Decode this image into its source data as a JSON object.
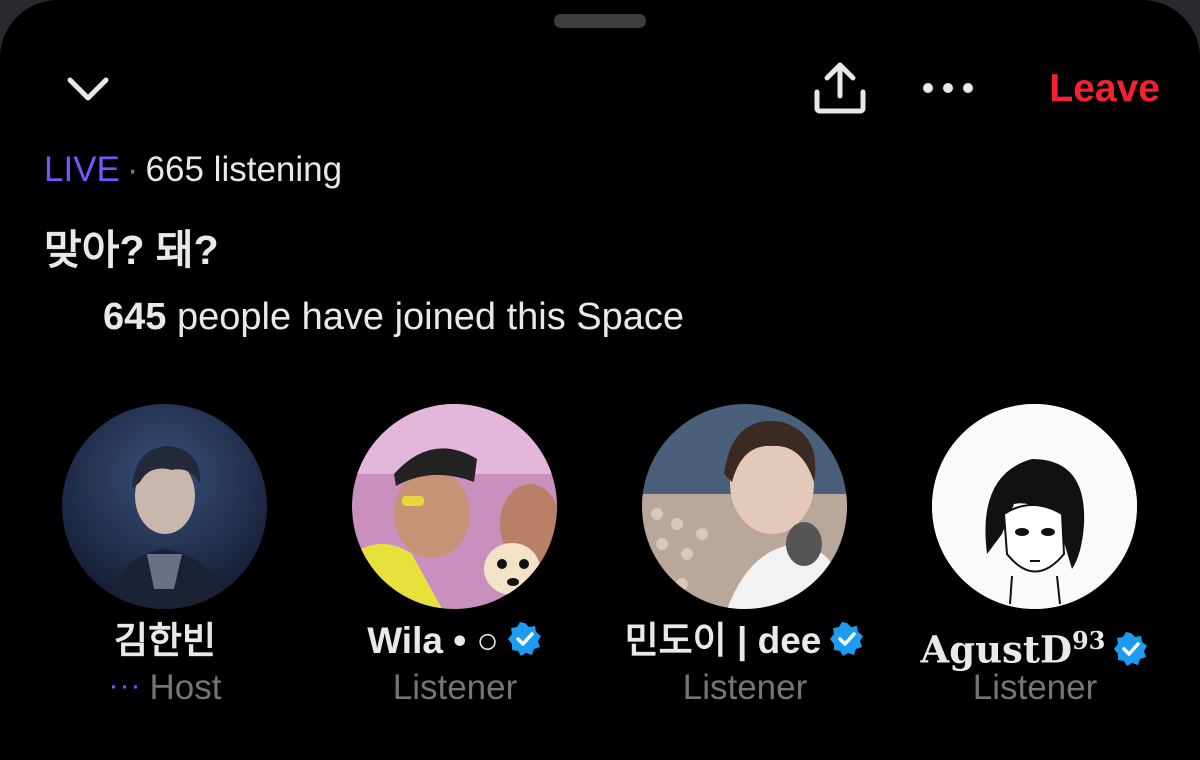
{
  "header": {
    "leave_label": "Leave"
  },
  "space": {
    "live_label": "LIVE",
    "separator": "·",
    "listening_text": "665 listening",
    "title": "맞아? 돼?",
    "joined_count": "645",
    "joined_text": " people have joined this Space"
  },
  "participants": [
    {
      "name": "김한빈",
      "role": "Host",
      "verified": false,
      "role_prefix": "···"
    },
    {
      "name": "Wila • ○",
      "role": "Listener",
      "verified": true
    },
    {
      "name": "민도이 | dee",
      "role": "Listener",
      "verified": true
    },
    {
      "name": "AgustD",
      "name_sup": "93",
      "role": "Listener",
      "verified": true
    }
  ],
  "colors": {
    "live": "#7856ff",
    "leave": "#f4212e",
    "verified": "#1d9bf0",
    "muted": "#71767b",
    "background": "#000000"
  },
  "icons": [
    "chevron-down-icon",
    "share-icon",
    "more-icon",
    "verified-icon"
  ]
}
